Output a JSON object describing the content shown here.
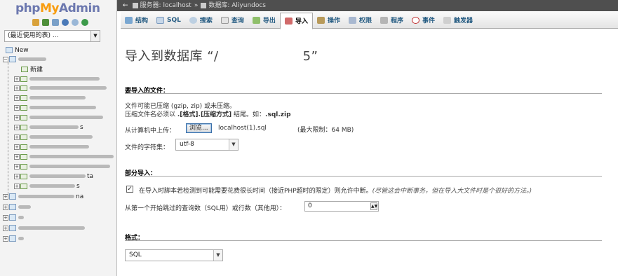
{
  "logo": {
    "php": "php",
    "my": "My",
    "admin": "Admin"
  },
  "sidebar": {
    "recent_label": "(最近使用的表) ...",
    "new_label": "New",
    "new_table_label": "新建",
    "tree_fragments": {
      "r1": "s",
      "r2": "ta",
      "r3": "s",
      "r4": "na"
    }
  },
  "breadcrumb": {
    "server_label": "服务器: localhost",
    "sep": "»",
    "db_label": "数据库: Aliyundocs"
  },
  "tabs": [
    {
      "label": "结构"
    },
    {
      "label": "SQL"
    },
    {
      "label": "搜索"
    },
    {
      "label": "查询"
    },
    {
      "label": "导出"
    },
    {
      "label": "导入"
    },
    {
      "label": "操作"
    },
    {
      "label": "权限"
    },
    {
      "label": "程序"
    },
    {
      "label": "事件"
    },
    {
      "label": "触发器"
    }
  ],
  "main": {
    "title_prefix": "导入到数据库 “/",
    "title_suffix": "5”",
    "file_section": "要导入的文件：",
    "compress_line1": "文件可能已压缩 (gzip, zip) 或未压缩。",
    "compress_line2_prefix": "压缩文件名必须以 ",
    "compress_line2_bold": ".[格式].[压缩方式]",
    "compress_line2_mid": " 结尾。如：",
    "compress_line2_example": ".sql.zip",
    "upload_label": "从计算机中上传：",
    "browse_label": "浏览...",
    "file_name": "localhost(1).sql",
    "max_limit": "(最大限制：64 MB)",
    "charset_label": "文件的字符集：",
    "charset_value": "utf-8",
    "partial_section": "部分导入：",
    "interrupt_text": "在导入时脚本若检测到可能需要花费很长时间（接近PHP超时的限定）则允许中断。",
    "interrupt_note": "(尽管这会中断事务，但在导入大文件时是个很好的方法。)",
    "skip_label": "从第一个开始跳过的查询数（SQL用）或行数（其他用）：",
    "skip_value": "0",
    "format_section": "格式：",
    "format_value": "SQL"
  },
  "colors": {
    "accent_blue": "#235a81",
    "logo_orange": "#f89c0e",
    "logo_blue": "#6c78af"
  }
}
